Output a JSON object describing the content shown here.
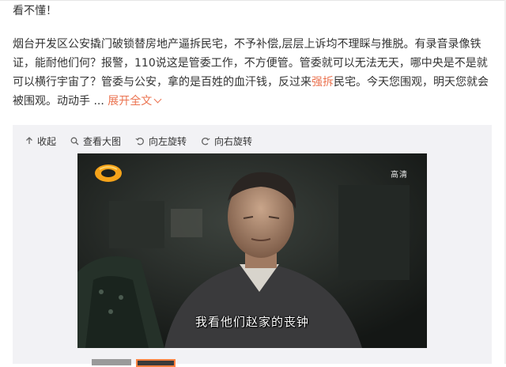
{
  "heading": "看不懂！",
  "post": {
    "text_before": "烟台开发区公安撬门破锁替房地产逼拆民宅，不予补偿,层层上诉均不理睬与推脱。有录音录像铁证，能耐他们何？报警，110说这是管委工作，不方便管。管委就可以无法无天，哪中央是不是就可以横行宇宙了？管委与公安，拿的是百姓的血汗钱，反过来",
    "highlight": "强拆",
    "text_after": "民宅。今天您围观，明天您就会被围观。动动手",
    "ellipsis": "...",
    "expand_label": "展开全文"
  },
  "toolbar": {
    "collapse_label": "收起",
    "view_large_label": "查看大图",
    "rotate_left_label": "向左旋转",
    "rotate_right_label": "向右旋转"
  },
  "video": {
    "hd_badge": "高清",
    "subtitle": "我看他们赵家的丧钟"
  },
  "colors": {
    "accent": "#eb7350",
    "thumb_active_border": "#ff8140",
    "media_bg": "#f2f2f5"
  }
}
